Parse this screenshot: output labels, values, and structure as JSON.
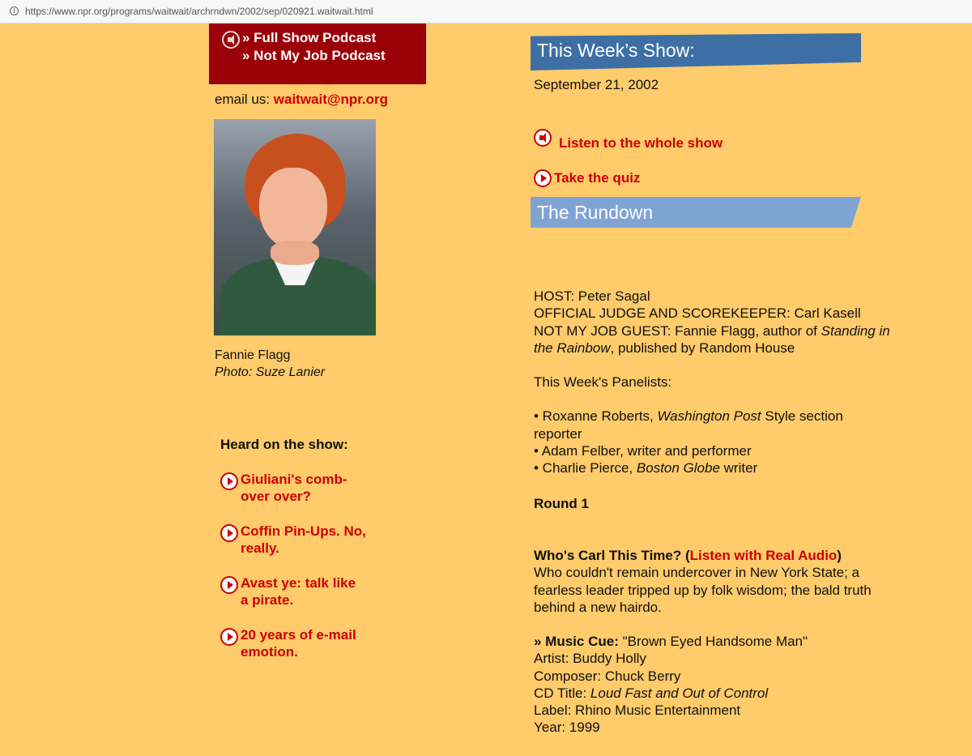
{
  "browser": {
    "url": "https://www.npr.org/programs/waitwait/archrndwn/2002/sep/020921.waitwait.html",
    "info_icon": "info-icon"
  },
  "sidebar": {
    "podcasts": [
      {
        "label": "» Full Show Podcast"
      },
      {
        "label": "» Not My Job Podcast"
      }
    ],
    "email_prefix": "email us:",
    "email_address": "waitwait@npr.org",
    "photo_caption_name": "Fannie Flagg",
    "photo_caption_credit": "Photo: Suze Lanier",
    "heard_title": "Heard on the show:",
    "heard_items": [
      {
        "line1": "Giuliani's comb-",
        "line2": "over over?"
      },
      {
        "line1": "Coffin Pin-Ups. No,",
        "line2": "really."
      },
      {
        "line1": "Avast ye: talk like",
        "line2": "a pirate."
      },
      {
        "line1": "20 years of e-mail",
        "line2": "emotion."
      }
    ]
  },
  "main": {
    "banner_this_week": "This Week’s Show:",
    "date": "September 21, 2002",
    "listen_label": "Listen to the whole show",
    "quiz_label": "Take the quiz",
    "banner_rundown": "The Rundown",
    "host_line": "HOST: Peter Sagal",
    "judge_line": "OFFICIAL JUDGE AND SCOREKEEPER: Carl Kasell",
    "guest_prefix": "NOT MY JOB GUEST: Fannie Flagg, author of",
    "guest_book_1": "Standing in",
    "guest_book_2": "the Rainbow",
    "guest_suffix": ", published by Random House",
    "panelists_title": "This Week's Panelists:",
    "panelist_1_name": "• Roxanne Roberts,",
    "panelist_1_pub": "Washington Post",
    "panelist_1_rest_a": "Style section",
    "panelist_1_rest_b": "reporter",
    "panelist_2": "• Adam Felber, writer and performer",
    "panelist_3_name": "• Charlie Pierce,",
    "panelist_3_pub": "Boston Globe",
    "panelist_3_rest": "writer",
    "round": "Round 1",
    "segment_title": "Who's Carl This Time? (",
    "segment_link": "Listen with Real Audio",
    "segment_close": ")",
    "segment_desc_1": "Who couldn't remain undercover in New York State; a",
    "segment_desc_2": "fearless leader tripped up by folk wisdom; the bald truth",
    "segment_desc_3": "behind a new hairdo.",
    "music_cue_label": "» Music Cue:",
    "music_cue_song": "\"Brown Eyed Handsome Man\"",
    "artist": "Artist: Buddy Holly",
    "composer": "Composer: Chuck Berry",
    "cd_title_prefix": "CD Title:",
    "cd_title": "Loud Fast and Out of Control",
    "label": "Label: Rhino Music Entertainment",
    "year": "Year: 1999"
  }
}
